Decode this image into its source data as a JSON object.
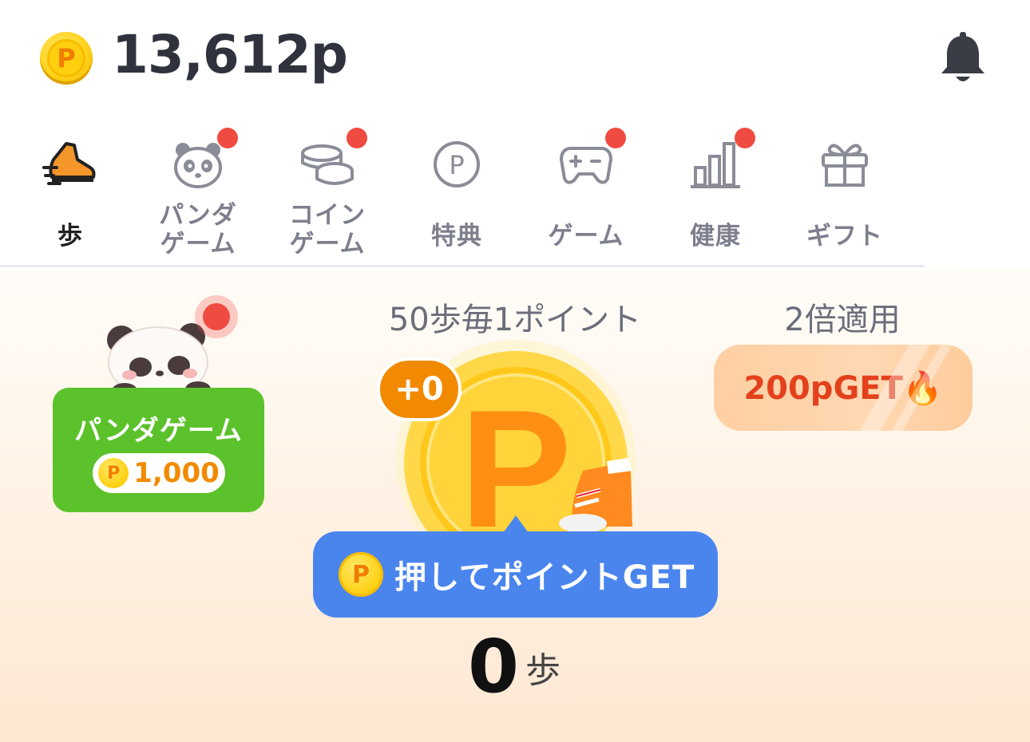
{
  "header": {
    "coin_icon": "point-coin-icon",
    "balance": "13,612p",
    "bell_icon": "bell-icon"
  },
  "tabs": [
    {
      "label_lines": [
        "歩"
      ],
      "icon": "sneaker-icon",
      "active": true,
      "badge": false
    },
    {
      "label_lines": [
        "パンダ",
        "ゲーム"
      ],
      "icon": "panda-icon",
      "active": false,
      "badge": true
    },
    {
      "label_lines": [
        "コイン",
        "ゲーム"
      ],
      "icon": "coins-icon",
      "active": false,
      "badge": true
    },
    {
      "label_lines": [
        "特典"
      ],
      "icon": "p-circle-icon",
      "active": false,
      "badge": false
    },
    {
      "label_lines": [
        "ゲーム"
      ],
      "icon": "gamepad-icon",
      "active": false,
      "badge": true
    },
    {
      "label_lines": [
        "健康"
      ],
      "icon": "bar-chart-icon",
      "active": false,
      "badge": true
    },
    {
      "label_lines": [
        "ギフト"
      ],
      "icon": "gift-icon",
      "active": false,
      "badge": false
    }
  ],
  "main": {
    "panda_card": {
      "title": "パンダゲーム",
      "points": "1,000"
    },
    "rule_text": "50歩毎1ポイント",
    "double_text": "2倍適用",
    "get_button": "200pGET🔥",
    "plus_badge": "+0",
    "tooltip": "押してポイントGET",
    "steps_value": "0",
    "steps_unit": "歩"
  },
  "colors": {
    "accent_orange": "#f28a00",
    "panda_green": "#5cc22b",
    "tooltip_blue": "#4a85ee",
    "badge_red": "#f04b42",
    "get_text": "#e3411c"
  }
}
